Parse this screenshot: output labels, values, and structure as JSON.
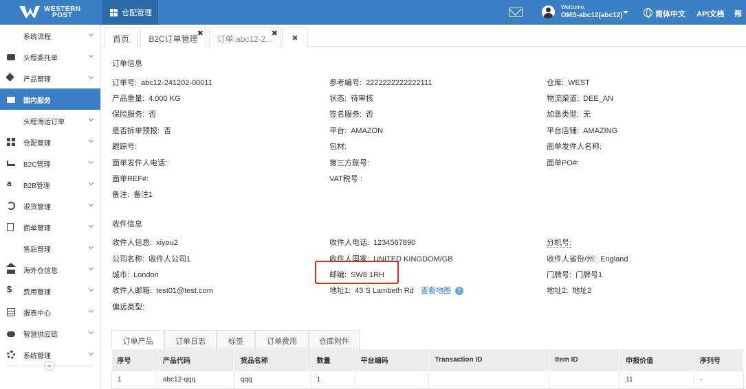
{
  "header": {
    "logo_line1": "WESTERN",
    "logo_line2": "POST",
    "module_tab": "仓配管理",
    "welcome": "Welcome,",
    "user": "OMS-abc12(abc12)",
    "language": "简体中文",
    "api_docs": "API文档",
    "help": "帮"
  },
  "sidebar": {
    "items": [
      {
        "label": "系统流程",
        "icon": "none"
      },
      {
        "label": "头程委托单",
        "icon": "briefcase-icon"
      },
      {
        "label": "产品管理",
        "icon": "tag-icon"
      },
      {
        "label": "国内服务",
        "icon": "folder-icon",
        "active": true
      },
      {
        "label": "头程海运订单",
        "icon": "none"
      },
      {
        "label": "仓配管理",
        "icon": "grid-icon"
      },
      {
        "label": "B2C管理",
        "icon": "cart-icon"
      },
      {
        "label": "B2B管理",
        "icon": "amazon-icon"
      },
      {
        "label": "退货管理",
        "icon": "undo-icon"
      },
      {
        "label": "面单管理",
        "icon": "document-icon"
      },
      {
        "label": "售后管理",
        "icon": "none"
      },
      {
        "label": "海外仓信息",
        "icon": "home-icon"
      },
      {
        "label": "费用管理",
        "icon": "dollar-icon"
      },
      {
        "label": "报表中心",
        "icon": "table-icon"
      },
      {
        "label": "智慧供应链",
        "icon": "cloud-icon"
      },
      {
        "label": "系统管理",
        "icon": "gear-icon"
      }
    ],
    "collapse": "«"
  },
  "tabs": [
    {
      "label": "首页"
    },
    {
      "label": "B2C订单管理"
    },
    {
      "label": "订单:abc12-2..."
    }
  ],
  "order_info": {
    "title": "订单信息",
    "order_no_label": "订单号:",
    "order_no": "abc12-241202-00011",
    "ref_no_label": "参考编号:",
    "ref_no": "2222222222222111",
    "warehouse_label": "仓库:",
    "warehouse": "WEST",
    "weight_label": "产品重量:",
    "weight": "4.000 KG",
    "status_label": "状态:",
    "status": "待审核",
    "channel_label": "物流渠道:",
    "channel": "DEE_AN",
    "insurance_label": "保险服务:",
    "insurance": "否",
    "signature_label": "签名服务:",
    "signature": "否",
    "rush_label": "加急类型:",
    "rush": "无",
    "split_label": "是否拆单预报:",
    "split": "否",
    "platform_label": "平台:",
    "platform": "AMAZON",
    "shop_label": "平台店铺:",
    "shop": "AMAZING",
    "tracking_label": "跟踪号:",
    "package_label": "包材:",
    "sender_name_label": "面单发件人名称:",
    "sender_phone_label": "面单发件人电话:",
    "third_party_label": "第三方账号:",
    "po_label": "面单PO#:",
    "ref_label": "面单REF#:",
    "vat_label": "VAT税号 :",
    "remark_label": "备注:",
    "remark": "备注1"
  },
  "receiver_info": {
    "title": "收件信息",
    "name_label": "收件人信息:",
    "name": "xiyou2",
    "phone_label": "收件人电话:",
    "phone": "1234567890",
    "ext_label": "分机号:",
    "company_label": "公司名称:",
    "company": "收件人公司1",
    "country_label": "收件人国家:",
    "country": "UNITED KINGDOM/GB",
    "province_label": "收件人省份/州:",
    "province": "England",
    "city_label": "城市:",
    "city": "London",
    "postcode_label": "邮编:",
    "postcode": "SW8 1RH",
    "door_label": "门牌号:",
    "door": "门牌号1",
    "email_label": "收件人邮箱:",
    "email": "test01@test.com",
    "address1_label": "地址1:",
    "address1": "43 S Lambeth Rd",
    "map_link": "查看地图",
    "address2_label": "地址2:",
    "address2": "地址2",
    "remote_label": "偏远类型:"
  },
  "bottom_tabs": [
    "订单产品",
    "订单日志",
    "标签",
    "订单费用",
    "仓库附件"
  ],
  "product_table": {
    "headers": [
      "序号",
      "产品代码",
      "货品名称",
      "数量",
      "平台编码",
      "Transaction ID",
      "Item ID",
      "申报价值",
      "序列号"
    ],
    "rows": [
      [
        "1",
        "abc12-qqq",
        "qqq",
        "1",
        "",
        "",
        "",
        "11",
        "-"
      ]
    ]
  },
  "colors": {
    "primary": "#3b7fc4",
    "highlight": "#e0251b",
    "link": "#2b7cd3"
  }
}
